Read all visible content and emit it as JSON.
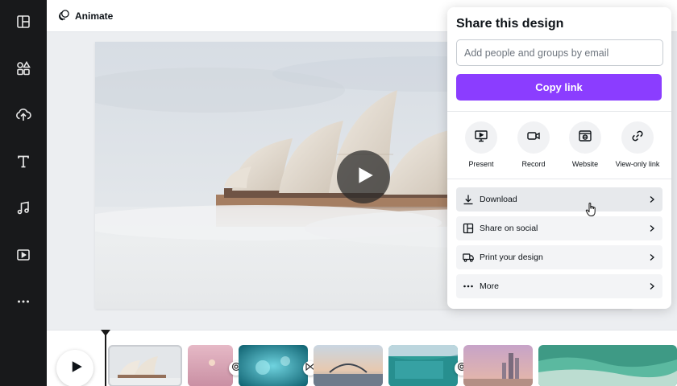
{
  "sidebar": {
    "items": [
      {
        "icon": "layout-icon"
      },
      {
        "icon": "elements-icon"
      },
      {
        "icon": "upload-icon"
      },
      {
        "icon": "text-icon"
      },
      {
        "icon": "audio-icon"
      },
      {
        "icon": "video-icon"
      },
      {
        "icon": "more-icon"
      }
    ]
  },
  "toolbar": {
    "animate_label": "Animate"
  },
  "share": {
    "title": "Share this design",
    "email_placeholder": "Add people and groups by email",
    "copy_link_label": "Copy link",
    "quick_actions": [
      {
        "label": "Present",
        "icon": "present-icon"
      },
      {
        "label": "Record",
        "icon": "record-icon"
      },
      {
        "label": "Website",
        "icon": "website-icon"
      },
      {
        "label": "View-only link",
        "icon": "link-icon"
      }
    ],
    "options": [
      {
        "label": "Download",
        "icon": "download-icon"
      },
      {
        "label": "Share on social",
        "icon": "social-icon"
      },
      {
        "label": "Print your design",
        "icon": "truck-icon"
      },
      {
        "label": "More",
        "icon": "more-dots-icon"
      }
    ]
  },
  "colors": {
    "primary": "#8b3dff",
    "sidebar_bg": "#18191b"
  }
}
